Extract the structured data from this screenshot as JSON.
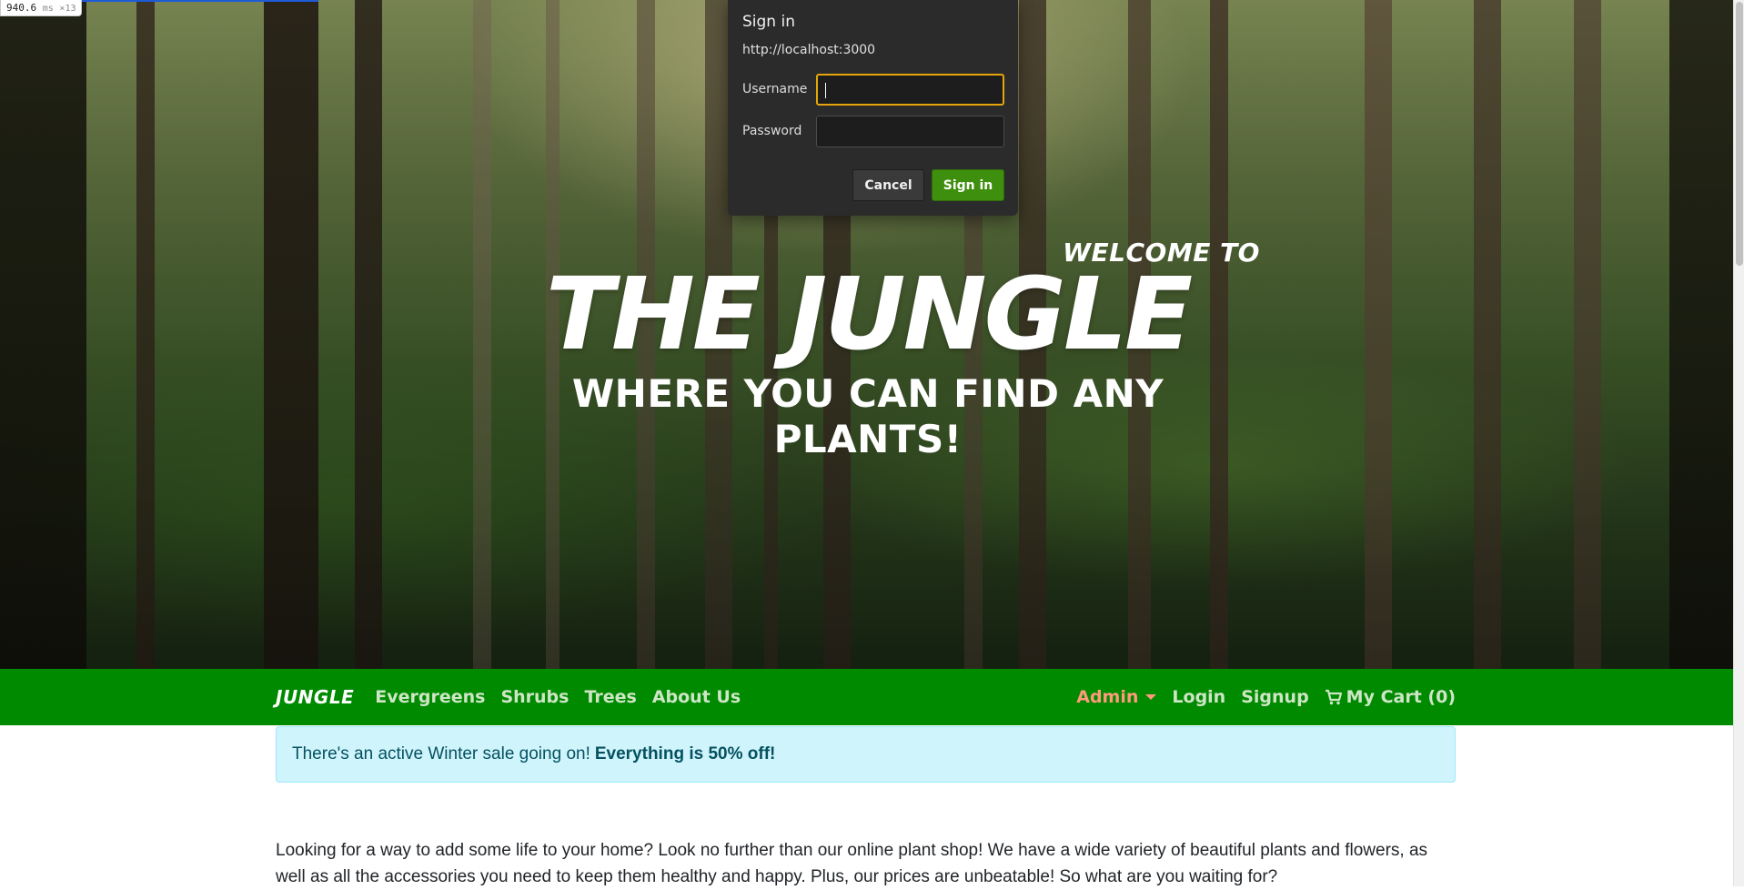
{
  "perf": {
    "value": "940.6",
    "unit": "ms",
    "multiplier": "×13"
  },
  "hero": {
    "welcome": "WELCOME TO",
    "title": "THE JUNGLE",
    "subtitle": "WHERE YOU CAN FIND ANY PLANTS!"
  },
  "nav": {
    "brand": "JUNGLE",
    "links": [
      "Evergreens",
      "Shrubs",
      "Trees",
      "About Us"
    ],
    "admin": "Admin",
    "login": "Login",
    "signup": "Signup",
    "cart": "My Cart (0)"
  },
  "alert": {
    "text": "There's an active Winter sale going on!",
    "bold": "Everything is 50% off!"
  },
  "intro": "Looking for a way to add some life to your home? Look no further than our online plant shop! We have a wide variety of beautiful plants and flowers, as well as all the accessories you need to keep them healthy and happy. Plus, our prices are unbeatable! So what are you waiting for?",
  "dialog": {
    "title": "Sign in",
    "origin": "http://localhost:3000",
    "username_label": "Username",
    "username_value": "",
    "password_label": "Password",
    "password_value": "",
    "cancel_label": "Cancel",
    "signin_label": "Sign in"
  },
  "colors": {
    "navbar": "#008a00",
    "alert_bg": "#cff4fc",
    "admin": "#ff9a7a",
    "signin_button": "#3f8f0e",
    "focus_ring": "#e5a50a"
  }
}
